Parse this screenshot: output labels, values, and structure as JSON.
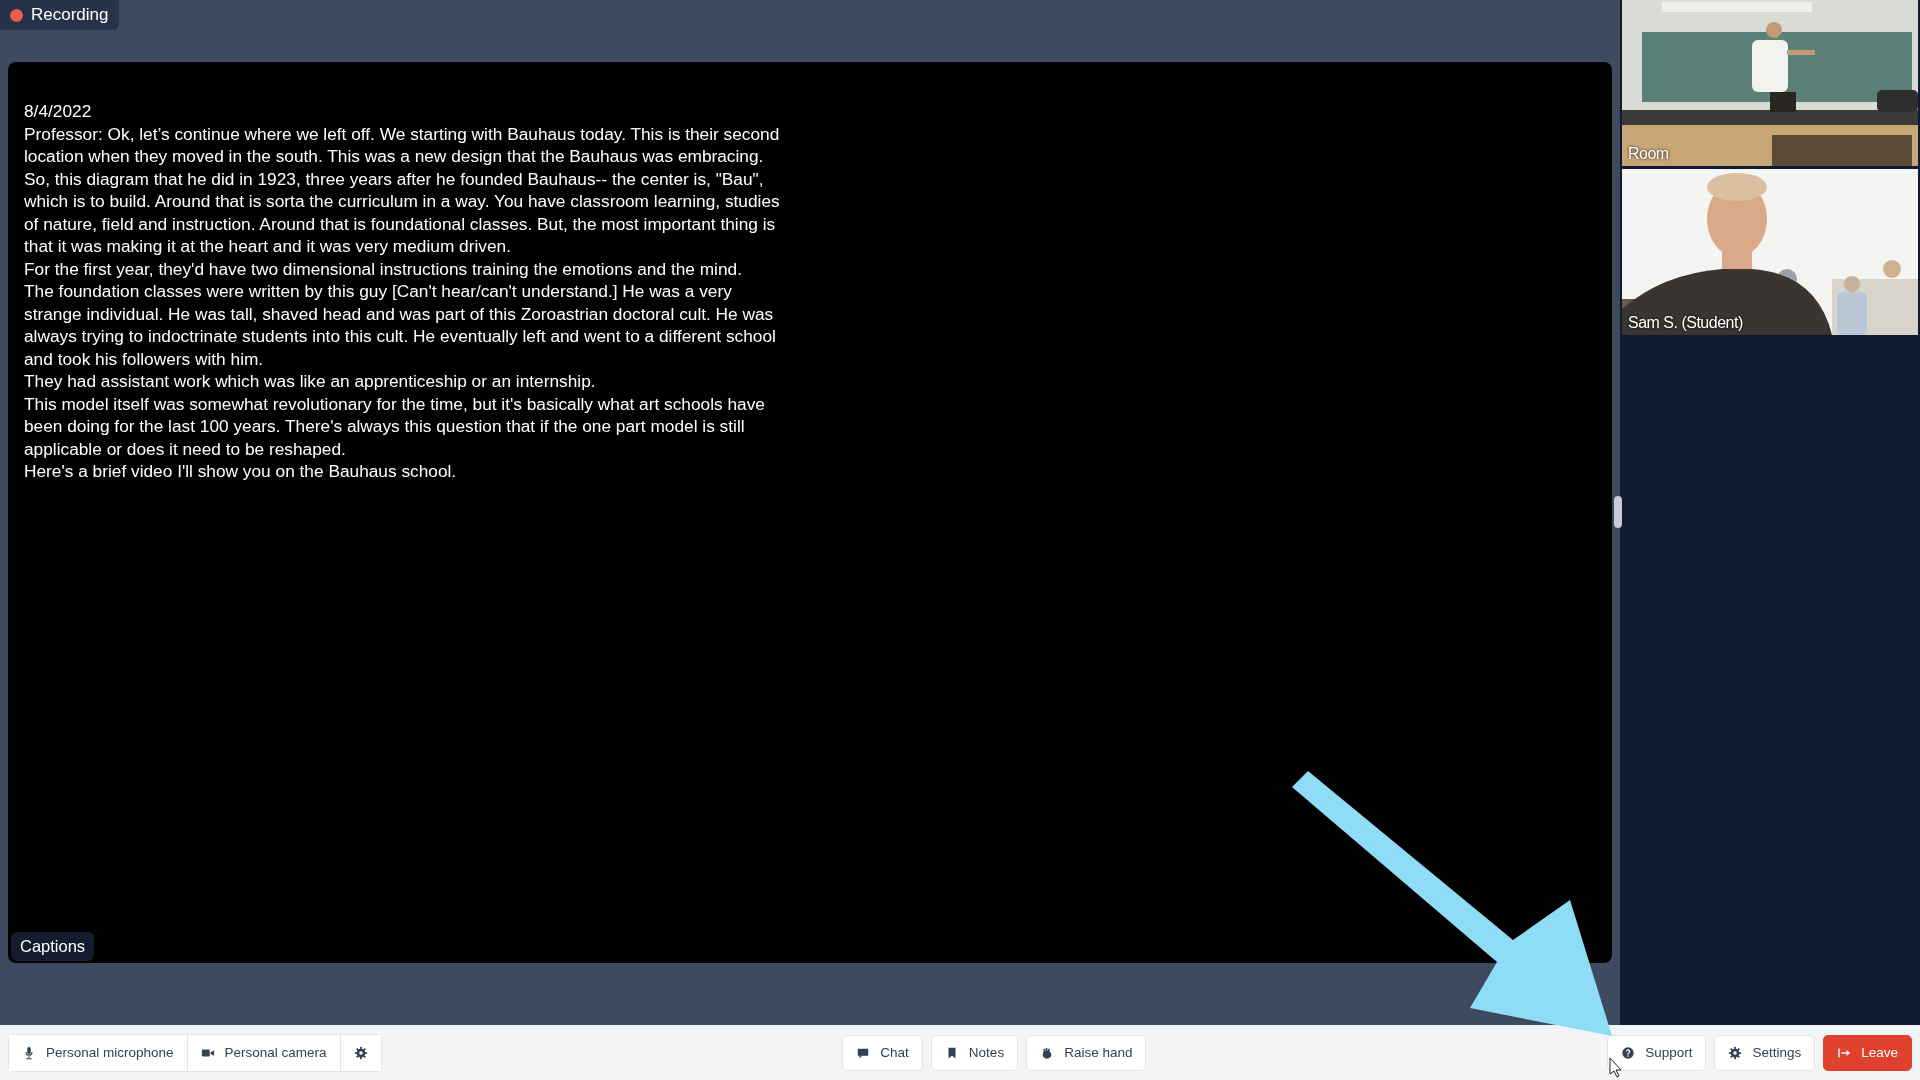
{
  "recording": {
    "label": "Recording",
    "on": true
  },
  "captions": {
    "date": "8/4/2022",
    "paragraphs": [
      "Professor: Ok, let’s continue where we left off. We starting with Bauhaus today. This is their second location when they moved in the south. This was a new design that the Bauhaus was embracing.",
      "So, this diagram that he did in 1923, three years after he founded Bauhaus-- the center is, \"Bau\", which is to build. Around that is sorta the curriculum in a way. You have classroom learning, studies of nature, field and instruction. Around that is foundational classes. But, the most important thing is that it was making it at the heart and it was very medium driven.",
      "For the first year, they'd have two dimensional instructions training the emotions and the mind.",
      "The foundation classes were written by this guy [Can't hear/can't understand.] He was a very strange individual. He was tall, shaved head and was part of this Zoroastrian doctoral cult. He was always trying to indoctrinate students into this cult. He eventually left and went to a different school and took his followers with him.",
      "They had assistant work which was like an apprenticeship or an internship.",
      "This model itself was somewhat revolutionary for the time, but it's basically what art schools have been doing for the last 100 years. There's always this question that if the one part model is still applicable or does it need to be reshaped.",
      "Here's a brief video I'll show you on the Bauhaus school."
    ],
    "label": "Captions"
  },
  "videos": [
    {
      "label": "Room",
      "kind": "room"
    },
    {
      "label": "Sam S. (Student)",
      "kind": "person"
    }
  ],
  "toolbar": {
    "left": [
      {
        "label": "Personal microphone",
        "kind": "mic"
      },
      {
        "label": "Personal camera",
        "kind": "camera"
      },
      {
        "kind": "settings"
      }
    ],
    "middle": [
      {
        "label": "Chat",
        "kind": "chat"
      },
      {
        "label": "Notes",
        "kind": "notes"
      },
      {
        "label": "Raise hand",
        "kind": "hand"
      }
    ],
    "right": [
      {
        "label": "Support",
        "kind": "support"
      },
      {
        "label": "Settings",
        "kind": "settings"
      },
      {
        "label": "Leave",
        "kind": "leave"
      }
    ]
  }
}
